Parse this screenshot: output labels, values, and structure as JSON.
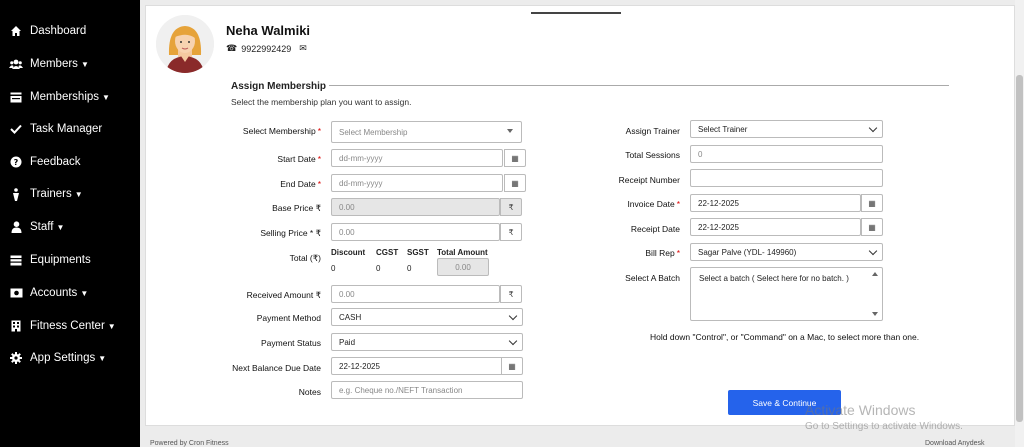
{
  "sidebar": {
    "items": [
      {
        "label": "Dashboard",
        "icon": "home-icon",
        "has_caret": false
      },
      {
        "label": "Members",
        "icon": "users-icon",
        "has_caret": true
      },
      {
        "label": "Memberships",
        "icon": "card-icon",
        "has_caret": true
      },
      {
        "label": "Task Manager",
        "icon": "check-icon",
        "has_caret": false
      },
      {
        "label": "Feedback",
        "icon": "question-icon",
        "has_caret": false
      },
      {
        "label": "Trainers",
        "icon": "trainer-icon",
        "has_caret": true
      },
      {
        "label": "Staff",
        "icon": "user-icon",
        "has_caret": true
      },
      {
        "label": "Equipments",
        "icon": "list-icon",
        "has_caret": false
      },
      {
        "label": "Accounts",
        "icon": "money-icon",
        "has_caret": true
      },
      {
        "label": "Fitness Center",
        "icon": "building-icon",
        "has_caret": true
      },
      {
        "label": "App Settings",
        "icon": "gear-icon",
        "has_caret": true
      }
    ]
  },
  "member": {
    "name": "Neha Walmiki",
    "phone": "9922992429"
  },
  "section": {
    "title": "Assign Membership",
    "subtitle": "Select the membership plan you want to assign."
  },
  "left_form": {
    "select_membership_label": "Select Membership",
    "select_membership_value": "Select Membership",
    "start_date_label": "Start Date",
    "start_date_placeholder": "dd-mm-yyyy",
    "end_date_label": "End Date",
    "end_date_placeholder": "dd-mm-yyyy",
    "base_price_label": "Base Price ₹",
    "base_price_value": "0.00",
    "selling_price_label": "Selling Price * ₹",
    "selling_price_value": "0.00",
    "total_label": "Total (₹)",
    "totals_headers": [
      "Discount",
      "CGST",
      "SGST",
      "Total Amount"
    ],
    "discount": "0",
    "cgst": "0",
    "sgst": "0",
    "total_amount": "0.00",
    "received_amount_label": "Received Amount ₹",
    "received_amount_value": "0.00",
    "payment_method_label": "Payment Method",
    "payment_method_value": "CASH",
    "payment_status_label": "Payment Status",
    "payment_status_value": "Paid",
    "next_due_label": "Next Balance Due Date",
    "next_due_value": "22-12-2025",
    "notes_label": "Notes",
    "notes_placeholder": "e.g. Cheque no./NEFT Transaction",
    "rupee": "₹"
  },
  "right_form": {
    "assign_trainer_label": "Assign Trainer",
    "assign_trainer_value": "Select Trainer",
    "total_sessions_label": "Total Sessions",
    "total_sessions_value": "0",
    "receipt_number_label": "Receipt Number",
    "receipt_number_value": "",
    "invoice_date_label": "Invoice Date",
    "invoice_date_value": "22-12-2025",
    "receipt_date_label": "Receipt Date",
    "receipt_date_value": "22-12-2025",
    "bill_rep_label": "Bill Rep",
    "bill_rep_value": "Sagar Palve (YDL- 149960)",
    "batch_label": "Select A Batch",
    "batch_option": "Select a batch ( Select here for no batch. )",
    "hint": "Hold down \"Control\", or \"Command\" on a Mac, to select more than one."
  },
  "actions": {
    "save_label": "Save & Continue"
  },
  "footer": {
    "left": "Powered by Cron Fitness",
    "right": "Download Anydesk"
  },
  "watermark": {
    "line1": "Activate Windows",
    "line2": "Go to Settings to activate Windows."
  },
  "colors": {
    "sidebar_bg": "#000000",
    "accent": "#2563eb",
    "required": "#dd0000"
  }
}
